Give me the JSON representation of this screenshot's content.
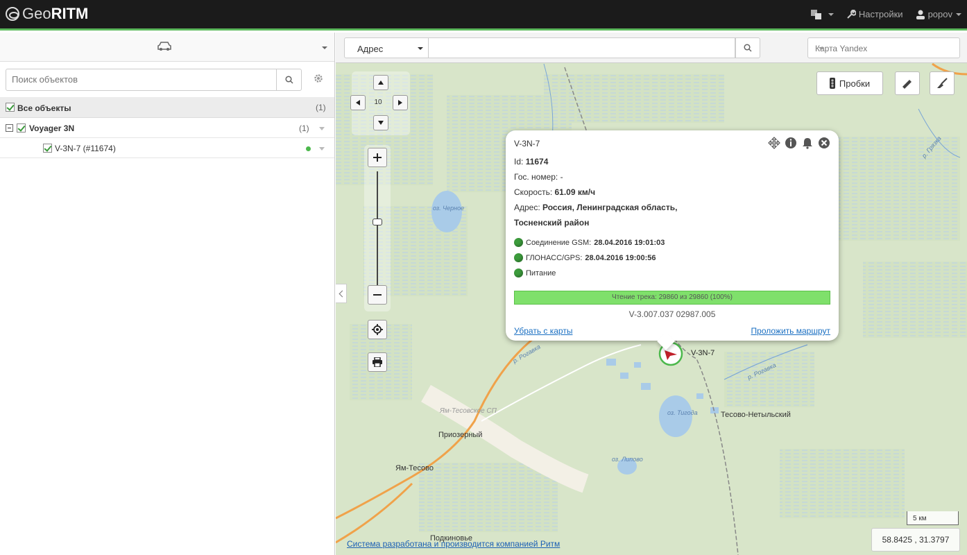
{
  "app": {
    "brand_geo": "Geo",
    "brand_ritm": "RITM"
  },
  "topbar": {
    "settings_label": "Настройки",
    "user_label": "popov"
  },
  "left": {
    "search_placeholder": "Поиск объектов",
    "tree": {
      "all_label": "Все объекты",
      "all_count": "(1)",
      "group_label": "Voyager 3N",
      "group_count": "(1)",
      "item_label": "V-3N-7 (#11674)"
    }
  },
  "map": {
    "search_type": "Адрес",
    "map_type": "Карта Yandex",
    "traffic_label": "Пробки",
    "zoom_level": "10",
    "scale_label": "5 км",
    "coords": "58.8425 , 31.3797",
    "copyright": "Система разработана и производится компанией Ритм",
    "labels": {
      "lake_chernoe": "оз. Черное",
      "lake_tigoda": "оз. Тигода",
      "lake_lipovo": "оз. Липово",
      "river1": "р. Рогавка",
      "river2": "р. Рогавка",
      "river3": "р. Грязка",
      "priozerny": "Приозерный",
      "yam_tesovo": "Ям-Тесово",
      "tesovo_net": "Тесово-Нетыльский",
      "podkinovie": "Подкиновье",
      "yam_sp": "Ям-Тесовское СП",
      "vehicle": "V-3N-7"
    }
  },
  "popup": {
    "title": "V-3N-7",
    "id_label": "Id:",
    "id_value": "11674",
    "gos_label": "Гос. номер:",
    "gos_value": "-",
    "speed_label": "Скорость:",
    "speed_value": "61.09 км/ч",
    "addr_label": "Адрес:",
    "addr_value1": "Россия, Ленинградская область,",
    "addr_value2": "Тосненский район",
    "gsm_label": "Соединение GSM:",
    "gsm_value": "28.04.2016 19:01:03",
    "gps_label": "ГЛОНАСС/GPS:",
    "gps_value": "28.04.2016 19:00:56",
    "power_label": "Питание",
    "progress_text": "Чтение трека: 29860 из 29860 (100%)",
    "progress_fraction": 1.0,
    "version": "V-3.007.037 02987.005",
    "remove_link": "Убрать с карты",
    "route_link": "Проложить маршрут"
  },
  "colors": {
    "accent": "#5cb85c",
    "topbar": "#1b1b1b",
    "link": "#1a6fc2",
    "status_green": "#3c9c3c"
  }
}
